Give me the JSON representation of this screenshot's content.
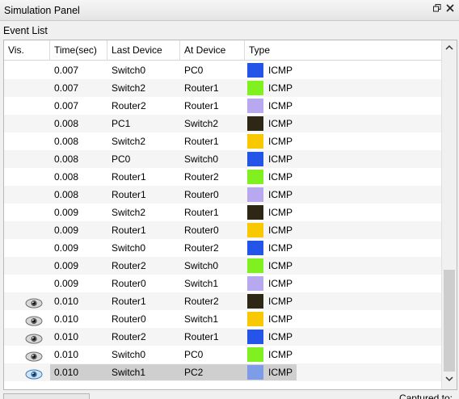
{
  "window": {
    "title": "Simulation Panel",
    "restore_icon": "restore-icon",
    "close_icon": "close-icon"
  },
  "section_label": "Event List",
  "columns": [
    "Vis.",
    "Time(sec)",
    "Last Device",
    "At Device",
    "Type"
  ],
  "rows": [
    {
      "vis": false,
      "time": "0.007",
      "last": "Switch0",
      "at": "PC0",
      "color": "#2455e8",
      "type": "ICMP"
    },
    {
      "vis": false,
      "time": "0.007",
      "last": "Switch2",
      "at": "Router1",
      "color": "#80f020",
      "type": "ICMP"
    },
    {
      "vis": false,
      "time": "0.007",
      "last": "Router2",
      "at": "Router1",
      "color": "#b8a8f0",
      "type": "ICMP"
    },
    {
      "vis": false,
      "time": "0.008",
      "last": "PC1",
      "at": "Switch2",
      "color": "#2e2716",
      "type": "ICMP"
    },
    {
      "vis": false,
      "time": "0.008",
      "last": "Switch2",
      "at": "Router1",
      "color": "#f8c800",
      "type": "ICMP"
    },
    {
      "vis": false,
      "time": "0.008",
      "last": "PC0",
      "at": "Switch0",
      "color": "#2455e8",
      "type": "ICMP"
    },
    {
      "vis": false,
      "time": "0.008",
      "last": "Router1",
      "at": "Router2",
      "color": "#80f020",
      "type": "ICMP"
    },
    {
      "vis": false,
      "time": "0.008",
      "last": "Router1",
      "at": "Router0",
      "color": "#b8a8f0",
      "type": "ICMP"
    },
    {
      "vis": false,
      "time": "0.009",
      "last": "Switch2",
      "at": "Router1",
      "color": "#2e2716",
      "type": "ICMP"
    },
    {
      "vis": false,
      "time": "0.009",
      "last": "Router1",
      "at": "Router0",
      "color": "#f8c800",
      "type": "ICMP"
    },
    {
      "vis": false,
      "time": "0.009",
      "last": "Switch0",
      "at": "Router2",
      "color": "#2455e8",
      "type": "ICMP"
    },
    {
      "vis": false,
      "time": "0.009",
      "last": "Router2",
      "at": "Switch0",
      "color": "#80f020",
      "type": "ICMP"
    },
    {
      "vis": false,
      "time": "0.009",
      "last": "Router0",
      "at": "Switch1",
      "color": "#b8a8f0",
      "type": "ICMP"
    },
    {
      "vis": true,
      "time": "0.010",
      "last": "Router1",
      "at": "Router2",
      "color": "#2e2716",
      "type": "ICMP"
    },
    {
      "vis": true,
      "time": "0.010",
      "last": "Router0",
      "at": "Switch1",
      "color": "#f8c800",
      "type": "ICMP"
    },
    {
      "vis": true,
      "time": "0.010",
      "last": "Router2",
      "at": "Router1",
      "color": "#2455e8",
      "type": "ICMP"
    },
    {
      "vis": true,
      "time": "0.010",
      "last": "Switch0",
      "at": "PC0",
      "color": "#80f020",
      "type": "ICMP"
    },
    {
      "vis": true,
      "time": "0.010",
      "last": "Switch1",
      "at": "PC2",
      "color": "#7e9ce8",
      "type": "ICMP",
      "selected": true
    }
  ],
  "footer_text": "Captured to:"
}
